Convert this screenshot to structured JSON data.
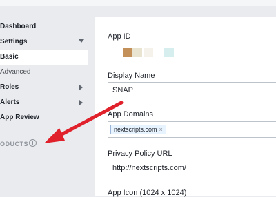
{
  "sidebar": {
    "items": [
      {
        "label": "Dashboard"
      },
      {
        "label": "Settings"
      },
      {
        "label": "Basic"
      },
      {
        "label": "Advanced"
      },
      {
        "label": "Roles"
      },
      {
        "label": "Alerts"
      },
      {
        "label": "App Review"
      }
    ],
    "products_label": "ODUCTS"
  },
  "form": {
    "app_id_label": "App ID",
    "app_id_swatches": [
      "#c4905a",
      "#e8e4cf",
      "#f4f2ea",
      "#d7eeee"
    ],
    "display_name_label": "Display Name",
    "display_name_value": "SNAP",
    "app_domains_label": "App Domains",
    "app_domain_tag": "nextscripts.com",
    "app_domain_remove": "×",
    "privacy_label": "Privacy Policy URL",
    "privacy_value": "http://nextscripts.com/",
    "app_icon_label": "App Icon (1024 x 1024)"
  },
  "colors": {
    "annotation_arrow": "#e0202a",
    "active_item_bg": "#ffffff",
    "sidebar_bg": "#e9ebee"
  }
}
